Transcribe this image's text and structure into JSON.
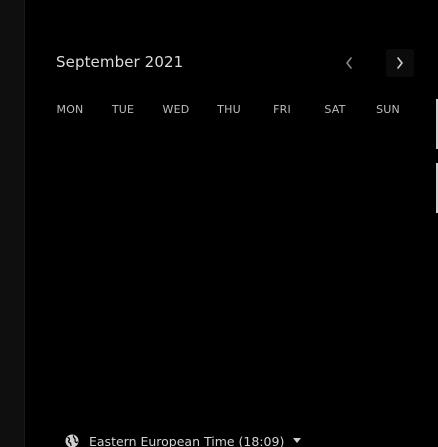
{
  "calendar": {
    "month_title": "September 2021",
    "weekdays": [
      "MON",
      "TUE",
      "WED",
      "THU",
      "FRI",
      "SAT",
      "SUN"
    ],
    "prev_icon": "chevron-left-icon",
    "next_icon": "chevron-right-icon"
  },
  "timezone": {
    "icon": "globe-icon",
    "label": "Eastern European Time (18:09)",
    "caret_icon": "caret-down-icon"
  },
  "colors": {
    "background": "#000000",
    "text_primary": "#dcdcdc",
    "text_muted": "#bdbdbd",
    "side_panel": "#0f0f0f"
  }
}
